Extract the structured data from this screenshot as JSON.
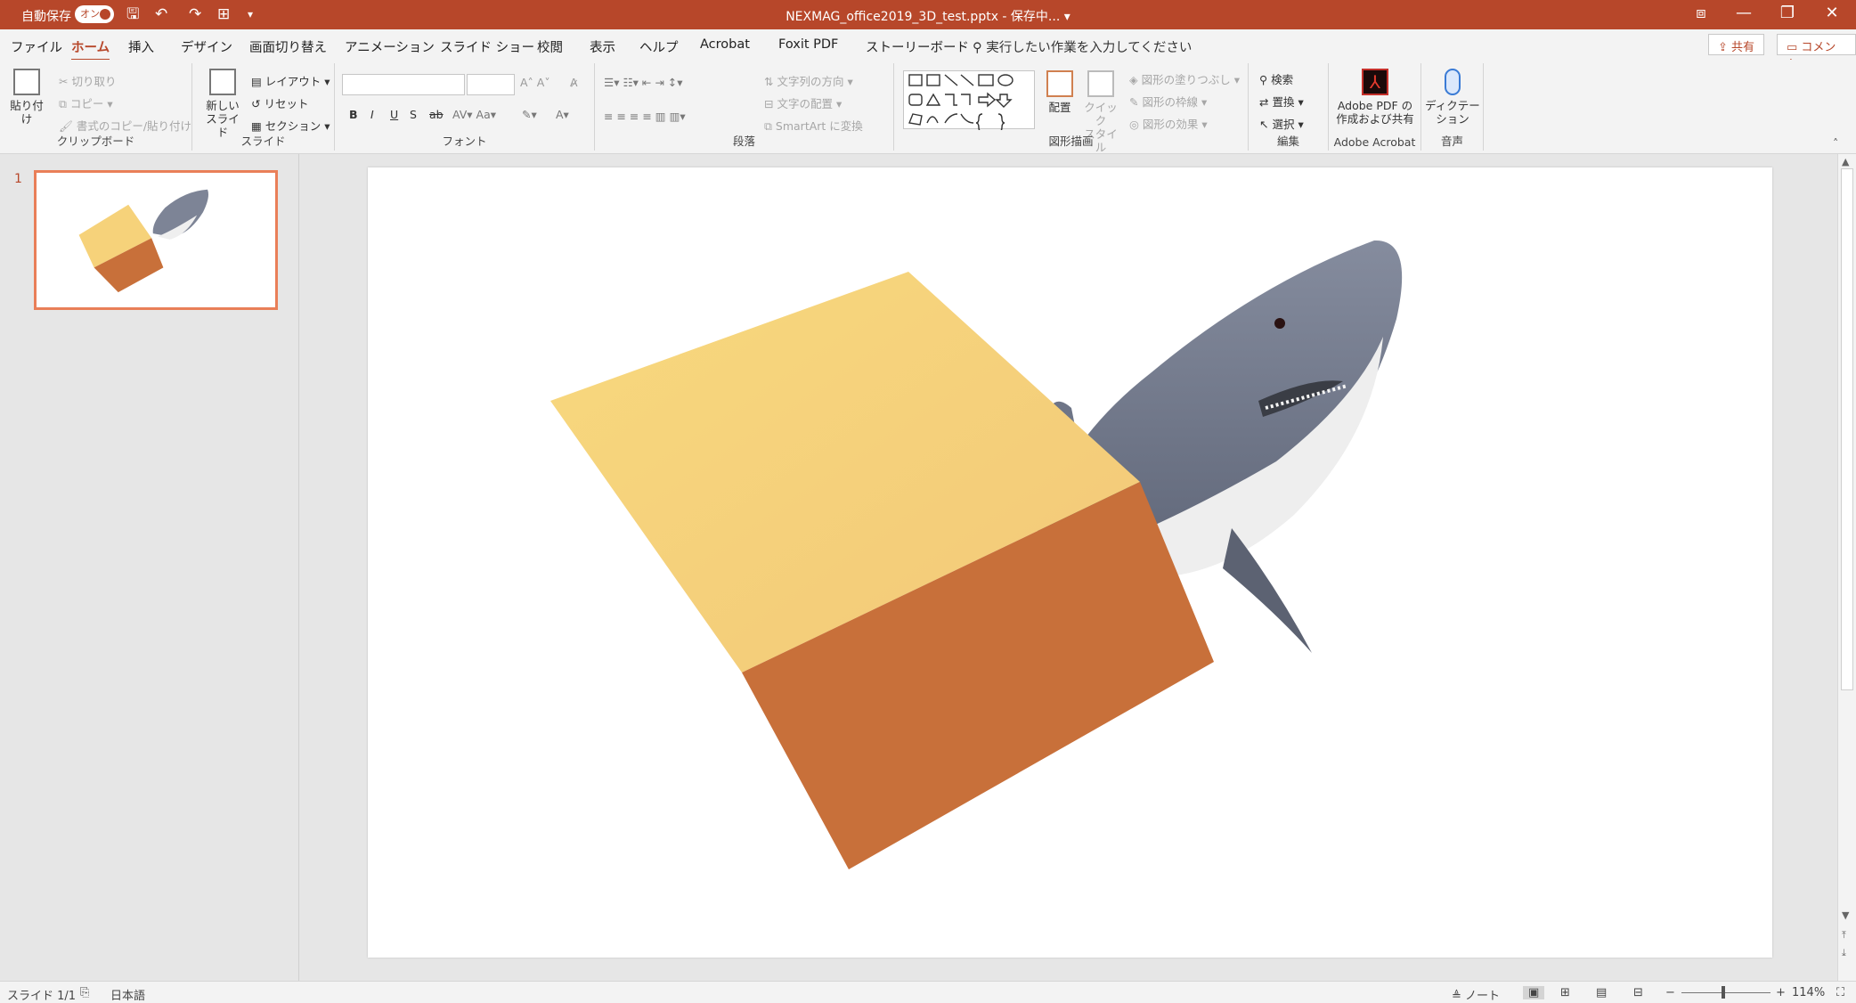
{
  "titlebar": {
    "autosave": "自動保存",
    "toggle": "オン",
    "document_title": "NEXMAG_office2019_3D_test.pptx - 保存中...",
    "title_arrow": "▾"
  },
  "tabs": [
    "ファイル",
    "ホーム",
    "挿入",
    "デザイン",
    "画面切り替え",
    "アニメーション",
    "スライド ショー",
    "校閲",
    "表示",
    "ヘルプ",
    "Acrobat",
    "Foxit PDF",
    "ストーリーボード"
  ],
  "search_text": "実行したい作業を入力してください",
  "share": "共有",
  "comment": "コメント",
  "ribbon": {
    "clipboard": {
      "paste": "貼り付け",
      "cut": "切り取り",
      "copy": "コピー",
      "format_painter": "書式のコピー/貼り付け",
      "label": "クリップボード"
    },
    "slides": {
      "new_slide_1": "新しい",
      "new_slide_2": "スライド",
      "layout": "レイアウト",
      "reset": "リセット",
      "section": "セクション",
      "label": "スライド"
    },
    "font": {
      "bold": "B",
      "italic": "I",
      "underline": "U",
      "shadow": "S",
      "strike": "ab",
      "label": "フォント"
    },
    "paragraph": {
      "text_direction": "文字列の方向",
      "align_text": "文字の配置",
      "smartart": "SmartArt に変換",
      "label": "段落"
    },
    "drawing": {
      "arrange": "配置",
      "quick_styles_1": "クイック",
      "quick_styles_2": "スタイル",
      "fill": "図形の塗りつぶし",
      "outline": "図形の枠線",
      "effects": "図形の効果",
      "label": "図形描画"
    },
    "editing": {
      "find": "検索",
      "replace": "置換",
      "select": "選択",
      "label": "編集"
    },
    "acrobat": {
      "create_1": "Adobe PDF の",
      "create_2": "作成および共有",
      "label": "Adobe Acrobat"
    },
    "voice": {
      "dictate_1": "ディクテー",
      "dictate_2": "ション",
      "label": "音声"
    }
  },
  "thumbnail": {
    "number": "1"
  },
  "statusbar": {
    "slide": "スライド 1/1",
    "language": "日本語",
    "notes": "ノート",
    "zoom": "114%"
  },
  "colors": {
    "accent": "#b7472a",
    "cube_top": "#f6d27a",
    "cube_front": "#c8703a",
    "shark_back": "#7d8496",
    "shark_belly": "#efefef"
  }
}
